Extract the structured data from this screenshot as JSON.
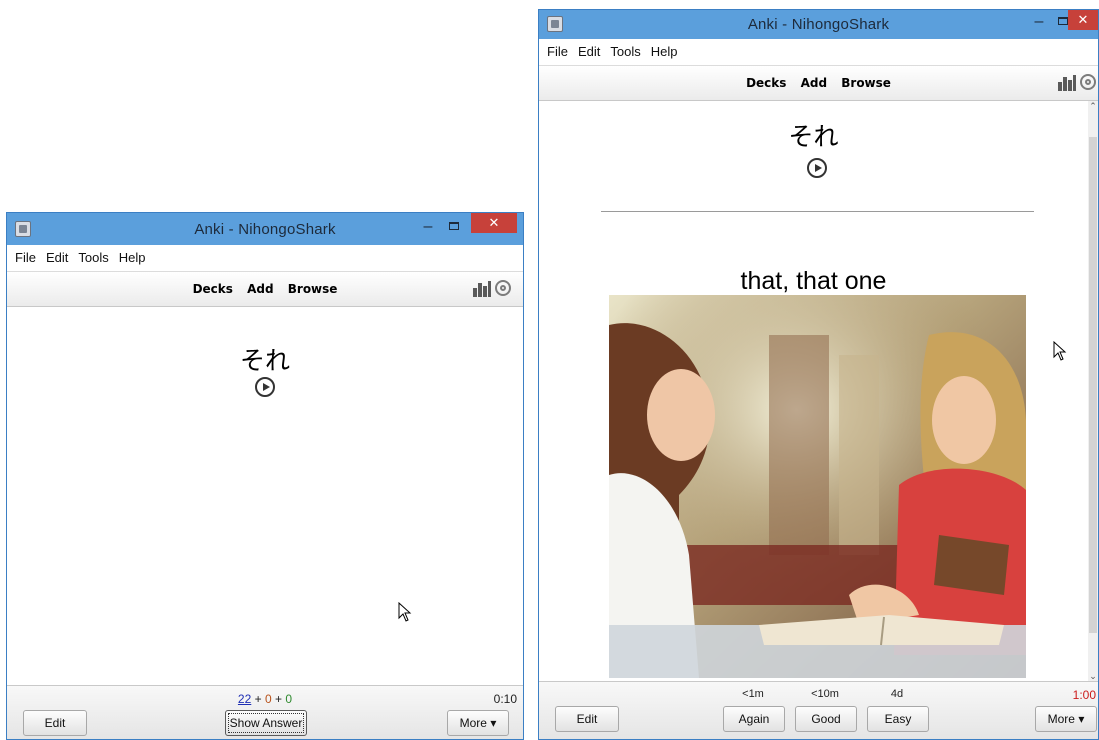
{
  "window1": {
    "title": "Anki - NihongoShark",
    "menu": [
      "File",
      "Edit",
      "Tools",
      "Help"
    ],
    "toolbar": [
      "Decks",
      "Add",
      "Browse"
    ],
    "card": {
      "front": "それ"
    },
    "bottom": {
      "edit_label": "Edit",
      "counts": {
        "new": "22",
        "learning": "0",
        "review": "0",
        "plus": "+"
      },
      "show_answer_label": "Show Answer",
      "more_label": "More ▾",
      "timer": "0:10"
    }
  },
  "window2": {
    "title": "Anki - NihongoShark",
    "menu": [
      "File",
      "Edit",
      "Tools",
      "Help"
    ],
    "toolbar": [
      "Decks",
      "Add",
      "Browse"
    ],
    "card": {
      "front": "それ",
      "back": "that, that one"
    },
    "bottom": {
      "edit_label": "Edit",
      "answers": [
        {
          "label": "Again",
          "interval": "<1m"
        },
        {
          "label": "Good",
          "interval": "<10m"
        },
        {
          "label": "Easy",
          "interval": "4d"
        }
      ],
      "more_label": "More ▾",
      "timer": "1:00"
    }
  },
  "colors": {
    "titlebar": "#5b9fdc",
    "close_button": "#c7413a",
    "new_count": "#1e2eb4",
    "learning_count": "#b8521b",
    "review_count": "#2f8a2f",
    "timer_overdue": "#cc1c1c"
  },
  "icons": {
    "app": "anki-app-icon",
    "minimize": "minimize-icon",
    "maximize": "maximize-icon",
    "close": "close-icon",
    "stats": "stats-icon",
    "sync": "sync-icon",
    "audio": "play-audio-icon",
    "cursor": "mouse-cursor-icon"
  }
}
